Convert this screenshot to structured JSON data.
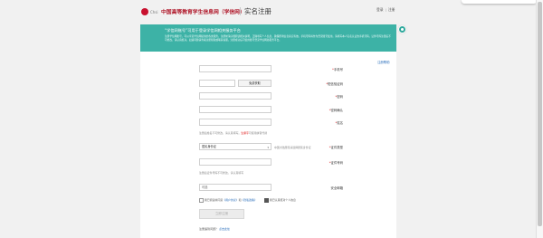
{
  "header": {
    "logo_text": "Chsi",
    "site_name": "中国高等教育学生信息网（学信网）",
    "page_title": "实名注册",
    "links": [
      "登录",
      "注册"
    ]
  },
  "notice": {
    "title": "“学信网账号”可用于登录学信网相关服务平台",
    "body": "注册学信网账号，可以享受学信网提供的各类服务。注册前请仔细阅读相关说明，正确填写个人信息，确保所填信息真实有效。手机号码将作为登录账号使用，请填写本人实名认证的手机号码。证件号码注册后不可修改，请认真核对。如遇问题请查看注册帮助或联系客服。注册成功后可使用账号登录学信网各服务平台。"
  },
  "form": {
    "help_link": "注册帮助",
    "fields": {
      "mobile": {
        "label": "手机号",
        "value": ""
      },
      "sms_code": {
        "label": "短信验证码",
        "value": "",
        "button": "免费获取"
      },
      "password": {
        "label": "密码",
        "value": ""
      },
      "password_confirm": {
        "label": "密码确认",
        "value": ""
      },
      "name": {
        "label": "姓名",
        "value": ""
      },
      "name_hint": {
        "normal": "注册后姓名不可修改，请认真填写。",
        "red": "生僻字",
        "tail": "可使用拼音代替"
      },
      "id_type": {
        "label": "证件类型",
        "selected": "居民身份证",
        "hint": "中国大陆居民请选择居民身份证"
      },
      "id_number": {
        "label": "证件号码",
        "value": "",
        "hint": "注册后证件号码不可修改，请认真填写"
      },
      "security": {
        "label": "安全邮箱",
        "value": "可选"
      }
    },
    "agreement": {
      "prefix": "我已阅读并同意",
      "link1": "《用户协议》",
      "and": "和",
      "link2": "《隐私政策》",
      "remember": "我已认真核对个人信息"
    },
    "submit_label": "立即注册",
    "bottom_note": "注册遇到问题？",
    "bottom_link": "点击此处"
  }
}
